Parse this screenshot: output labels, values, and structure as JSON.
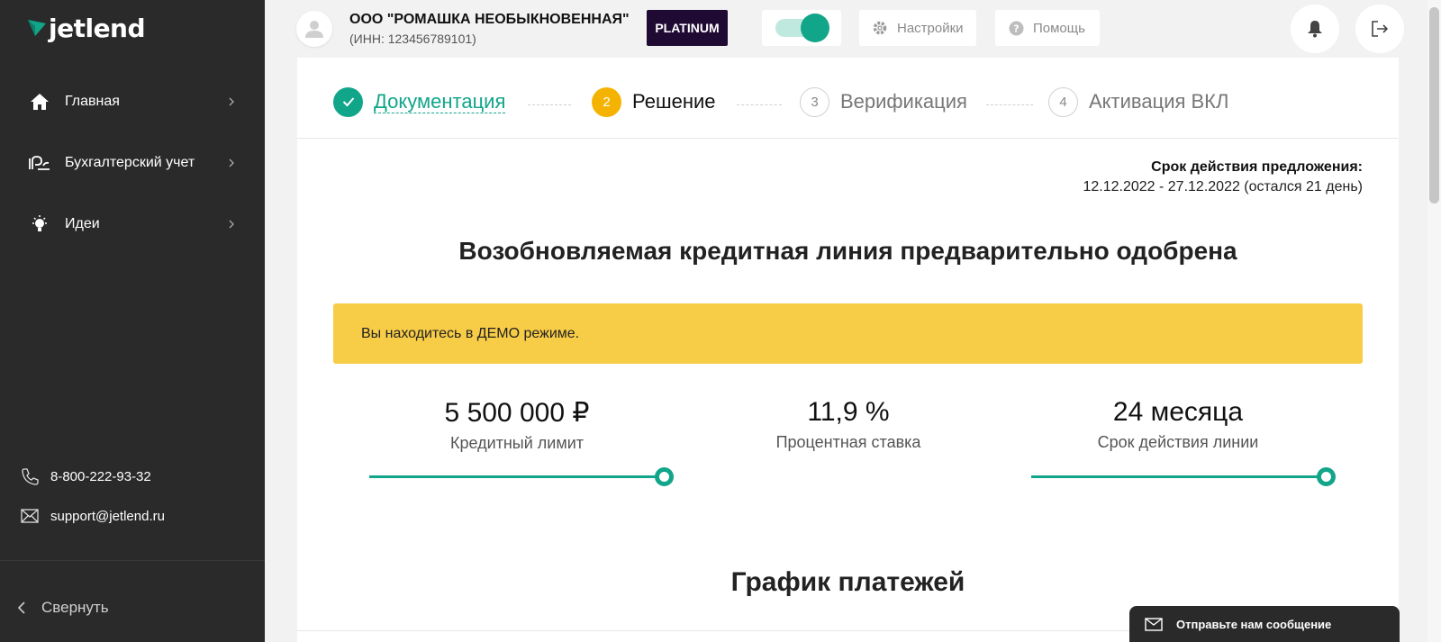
{
  "brand": {
    "logo_text": "jetlend",
    "accent_color": "#11a58a"
  },
  "sidebar": {
    "items": [
      {
        "label": "Главная",
        "icon": "home-icon"
      },
      {
        "label": "Бухгалтерский учет",
        "icon": "accounting-icon"
      },
      {
        "label": "Идеи",
        "icon": "lightbulb-icon"
      }
    ],
    "phone": "8-800-222-93-32",
    "email": "support@jetlend.ru",
    "collapse_label": "Свернуть"
  },
  "header": {
    "company_name": "ООО \"РОМАШКА НЕОБЫКНОВЕННАЯ\"",
    "company_inn": "(ИНН: 123456789101)",
    "badge": "PLATINUM",
    "settings_label": "Настройки",
    "help_label": "Помощь",
    "toggle_on": true
  },
  "steps": [
    {
      "number": "1",
      "label": "Документация",
      "state": "done"
    },
    {
      "number": "2",
      "label": "Решение",
      "state": "active"
    },
    {
      "number": "3",
      "label": "Верификация",
      "state": "todo"
    },
    {
      "number": "4",
      "label": "Активация ВКЛ",
      "state": "todo"
    }
  ],
  "offer": {
    "validity_title": "Срок действия предложения:",
    "validity_dates": "12.12.2022 - 27.12.2022 (остался 21 день)"
  },
  "main": {
    "heading": "Возобновляемая кредитная линия предварительно одобрена",
    "demo_notice": "Вы находитесь в ДЕМО режиме.",
    "metrics": [
      {
        "value": "5 500 000 ₽",
        "label": "Кредитный лимит",
        "slider_fraction": 1.0
      },
      {
        "value": "11,9 %",
        "label": "Процентная ставка"
      },
      {
        "value": "24 месяца",
        "label": "Срок действия линии",
        "slider_fraction": 1.0
      }
    ],
    "schedule_heading": "График платежей"
  },
  "chat": {
    "label": "Отправьте нам сообщение"
  }
}
